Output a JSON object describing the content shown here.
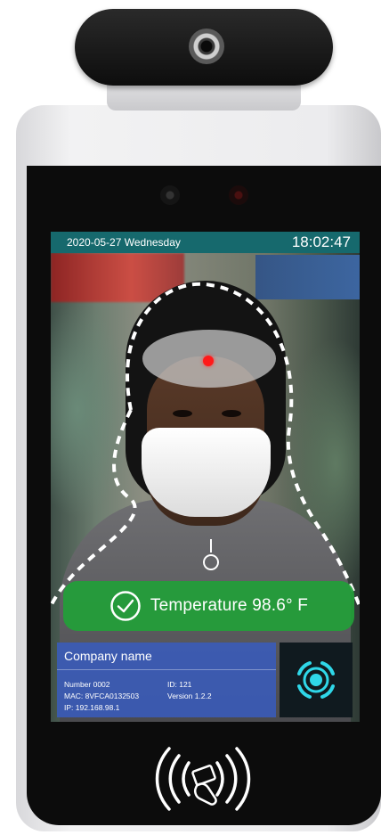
{
  "status_bar": {
    "date": "2020-05-27",
    "weekday": "Wednesday",
    "time": "18:02:47"
  },
  "temperature": {
    "label": "Temperature 98.6° F",
    "status_color": "#22a038"
  },
  "info_panel": {
    "company_name": "Company name",
    "number": "Number 0002",
    "id": "ID: 121",
    "mac": "MAC: 8VFCA0132503",
    "version": "Version 1.2.2",
    "ip": "IP: 192.168.98.1"
  },
  "icons": {
    "check": "check-circle-icon",
    "scan": "face-scan-icon",
    "nfc": "nfc-card-icon",
    "camera": "camera-lens-icon"
  },
  "colors": {
    "status_bar": "#16696d",
    "info_panel": "#385cbe",
    "target_dot": "#ff1a1a"
  }
}
